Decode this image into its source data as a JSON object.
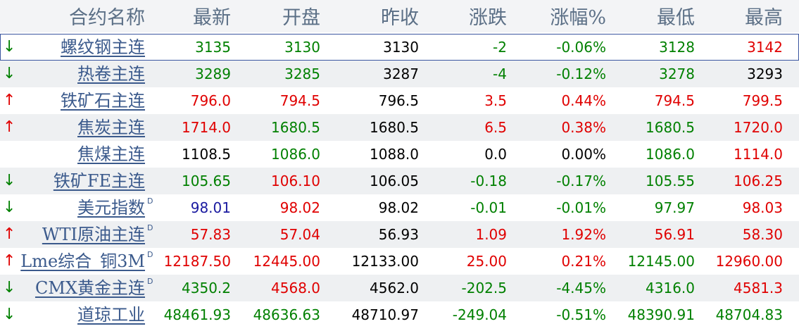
{
  "header": {
    "name": "合约名称",
    "latest": "最新",
    "open": "开盘",
    "prev_close": "昨收",
    "change": "涨跌",
    "change_pct": "涨幅%",
    "low": "最低",
    "high": "最高"
  },
  "colors": {
    "up": "#e00000",
    "down": "#008000",
    "neutral": "#000000",
    "special": "#1a1aa0",
    "name_link": "#3b5a8c",
    "header_text": "#5b6f86",
    "alt_row_bg": "#eef0f2"
  },
  "rows": [
    {
      "arrow": "↓",
      "dir": "down",
      "name": "螺纹钢主连",
      "flag": "",
      "latest": "3135",
      "latest_c": "green",
      "open": "3130",
      "open_c": "green",
      "prev": "3130",
      "change": "-2",
      "change_c": "green",
      "pct": "-0.06%",
      "pct_c": "green",
      "low": "3128",
      "low_c": "green",
      "high": "3142",
      "high_c": "red",
      "selected": true
    },
    {
      "arrow": "↓",
      "dir": "down",
      "name": "热卷主连",
      "flag": "",
      "latest": "3289",
      "latest_c": "green",
      "open": "3285",
      "open_c": "green",
      "prev": "3287",
      "change": "-4",
      "change_c": "green",
      "pct": "-0.12%",
      "pct_c": "green",
      "low": "3278",
      "low_c": "green",
      "high": "3293",
      "high_c": "black"
    },
    {
      "arrow": "↑",
      "dir": "up",
      "name": "铁矿石主连",
      "flag": "",
      "latest": "796.0",
      "latest_c": "red",
      "open": "794.5",
      "open_c": "red",
      "prev": "796.5",
      "change": "3.5",
      "change_c": "red",
      "pct": "0.44%",
      "pct_c": "red",
      "low": "794.5",
      "low_c": "red",
      "high": "799.5",
      "high_c": "red"
    },
    {
      "arrow": "↑",
      "dir": "up",
      "name": "焦炭主连",
      "flag": "",
      "latest": "1714.0",
      "latest_c": "red",
      "open": "1680.5",
      "open_c": "green",
      "prev": "1680.5",
      "change": "6.5",
      "change_c": "red",
      "pct": "0.38%",
      "pct_c": "red",
      "low": "1680.5",
      "low_c": "green",
      "high": "1720.0",
      "high_c": "red"
    },
    {
      "arrow": "",
      "dir": "",
      "name": "焦煤主连",
      "flag": "",
      "latest": "1108.5",
      "latest_c": "black",
      "open": "1086.0",
      "open_c": "green",
      "prev": "1088.0",
      "change": "0.0",
      "change_c": "black",
      "pct": "0.00%",
      "pct_c": "black",
      "low": "1086.0",
      "low_c": "green",
      "high": "1114.0",
      "high_c": "red"
    },
    {
      "arrow": "↓",
      "dir": "down",
      "name": "铁矿FE主连",
      "flag": "",
      "latest": "105.65",
      "latest_c": "green",
      "open": "106.10",
      "open_c": "red",
      "prev": "106.05",
      "change": "-0.18",
      "change_c": "green",
      "pct": "-0.17%",
      "pct_c": "green",
      "low": "105.55",
      "low_c": "green",
      "high": "106.25",
      "high_c": "red"
    },
    {
      "arrow": "↓",
      "dir": "down",
      "name": "美元指数",
      "flag": "D",
      "latest": "98.01",
      "latest_c": "navy",
      "open": "98.02",
      "open_c": "red",
      "prev": "98.02",
      "change": "-0.01",
      "change_c": "green",
      "pct": "-0.01%",
      "pct_c": "green",
      "low": "97.97",
      "low_c": "green",
      "high": "98.03",
      "high_c": "red"
    },
    {
      "arrow": "↑",
      "dir": "up",
      "name": "WTI原油主连",
      "flag": "D",
      "latest": "57.83",
      "latest_c": "red",
      "open": "57.04",
      "open_c": "red",
      "prev": "56.93",
      "change": "1.09",
      "change_c": "red",
      "pct": "1.92%",
      "pct_c": "red",
      "low": "56.91",
      "low_c": "red",
      "high": "58.30",
      "high_c": "red"
    },
    {
      "arrow": "↑",
      "dir": "up",
      "name": "Lme综合_铜3M",
      "flag": "D",
      "latest": "12187.50",
      "latest_c": "red",
      "open": "12445.00",
      "open_c": "red",
      "prev": "12133.00",
      "change": "25.00",
      "change_c": "red",
      "pct": "0.21%",
      "pct_c": "red",
      "low": "12145.00",
      "low_c": "green",
      "high": "12960.00",
      "high_c": "red"
    },
    {
      "arrow": "↓",
      "dir": "down",
      "name": "CMX黄金主连",
      "flag": "D",
      "latest": "4350.2",
      "latest_c": "green",
      "open": "4568.0",
      "open_c": "red",
      "prev": "4562.0",
      "change": "-202.5",
      "change_c": "green",
      "pct": "-4.45%",
      "pct_c": "green",
      "low": "4316.0",
      "low_c": "green",
      "high": "4581.3",
      "high_c": "red"
    },
    {
      "arrow": "↓",
      "dir": "down",
      "name": "道琼工业",
      "flag": "",
      "latest": "48461.93",
      "latest_c": "green",
      "open": "48636.63",
      "open_c": "green",
      "prev": "48710.97",
      "change": "-249.04",
      "change_c": "green",
      "pct": "-0.51%",
      "pct_c": "green",
      "low": "48390.91",
      "low_c": "green",
      "high": "48704.83",
      "high_c": "green"
    }
  ]
}
